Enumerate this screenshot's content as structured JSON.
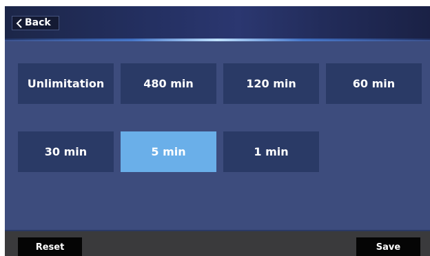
{
  "header": {
    "back_label": "Back"
  },
  "options": [
    {
      "label": "Unlimitation",
      "selected": false
    },
    {
      "label": "480 min",
      "selected": false
    },
    {
      "label": "120 min",
      "selected": false
    },
    {
      "label": "60 min",
      "selected": false
    },
    {
      "label": "30 min",
      "selected": false
    },
    {
      "label": "5 min",
      "selected": true
    },
    {
      "label": "1 min",
      "selected": false
    }
  ],
  "footer": {
    "reset_label": "Reset",
    "save_label": "Save"
  },
  "colors": {
    "panel_background": "#3d4c7d",
    "option_background": "#2a3a66",
    "selected_background": "#6aafe9",
    "footer_background": "#3a3a3c",
    "footer_button": "#050505"
  },
  "icons": {
    "back": "chevron-left-icon"
  }
}
